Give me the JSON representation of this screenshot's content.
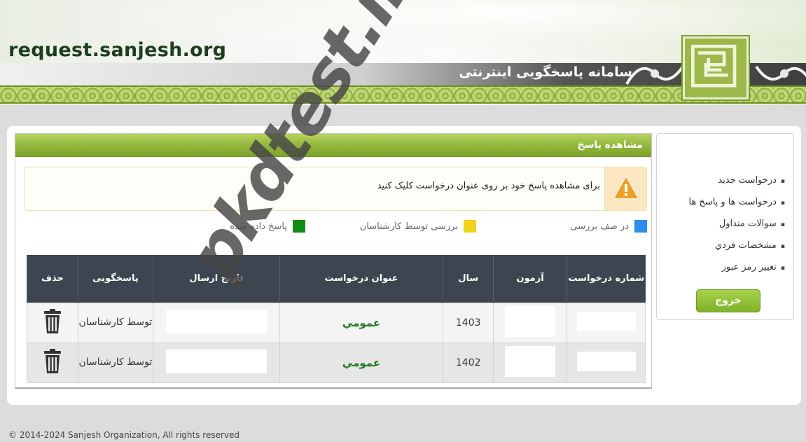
{
  "header": {
    "site_url": "request.sanjesh.org",
    "system_title": "سامانه پاسخگویی اینترنتی"
  },
  "panel": {
    "title": "مشاهده پاسخ",
    "alert_text": "برای مشاهده پاسخ خود بر روی عنوان درخواست کلیک کنید",
    "alert_icon": "warning-icon"
  },
  "legend": [
    {
      "label": "در صف بررسی",
      "color": "#2b8fe8"
    },
    {
      "label": "بررسی توسط کارشناسان",
      "color": "#f2d21b"
    },
    {
      "label": "پاسخ داده شده",
      "color": "#138a13"
    }
  ],
  "table": {
    "headers": {
      "request_number": "شماره درخواست",
      "exam": "آزمون",
      "year": "سال",
      "title": "عنوان درخواست",
      "send_date": "تاریخ ارسال",
      "responder": "پاسخگویی",
      "delete": "حذف"
    },
    "rows": [
      {
        "year": "1403",
        "title": "عمومي",
        "responder": "توسط کارشناسان",
        "delete_icon": "trash-icon"
      },
      {
        "year": "1402",
        "title": "عمومي",
        "responder": "توسط کارشناسان",
        "delete_icon": "trash-icon"
      }
    ]
  },
  "sidebar": {
    "items": [
      {
        "label": "درخواست جدید"
      },
      {
        "label": "درخواست ها و پاسخ ها"
      },
      {
        "label": "سوالات متداول"
      },
      {
        "label": "مشخصات فردي"
      },
      {
        "label": "تغییر رمز عبور"
      }
    ],
    "logout_label": "خروج"
  },
  "watermark": "pkdtest.ir",
  "footer": "© 2014-2024 Sanjesh Organization, All rights reserved"
}
